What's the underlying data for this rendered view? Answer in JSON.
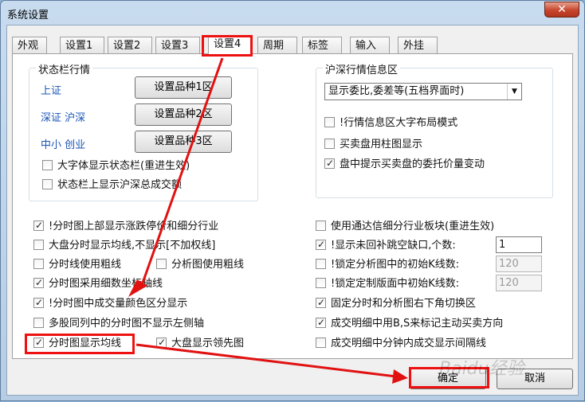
{
  "window": {
    "title": "系统设置",
    "close_glyph": "✕"
  },
  "tabs": [
    "外观",
    "设置1",
    "设置2",
    "设置3",
    "设置4",
    "周期",
    "标签",
    "输入",
    "外挂"
  ],
  "status_group": {
    "title": "状态栏行情",
    "rows": [
      {
        "label": "上证",
        "button": "设置品种1区"
      },
      {
        "label": "深证 沪深",
        "button": "设置品种2区"
      },
      {
        "label": "中小 创业",
        "button": "设置品种3区"
      }
    ],
    "checks": [
      {
        "label": "大字体显示状态栏(重进生效)",
        "checked": false
      },
      {
        "label": "状态栏上显示沪深总成交额",
        "checked": false
      }
    ]
  },
  "info_group": {
    "title": "沪深行情信息区",
    "select_value": "显示委比,委差等(五档界面时)",
    "checks": [
      {
        "label": "!行情信息区大字布局模式",
        "checked": false
      },
      {
        "label": "买卖盘用柱图显示",
        "checked": false
      },
      {
        "label": "盘中提示买卖盘的委托价量变动",
        "checked": true
      }
    ]
  },
  "left_checks": [
    {
      "label": "!分时图上部显示涨跌停价和细分行业",
      "checked": true
    },
    {
      "label": "大盘分时显示均线,不显示[不加权线]",
      "checked": false
    },
    {
      "label": "分时线使用粗线",
      "checked": false
    },
    {
      "label": "分析图使用粗线",
      "checked": false
    },
    {
      "label": "分时图采用细数坐标轴线",
      "checked": true
    },
    {
      "label": "!分时图中成交量颜色区分显示",
      "checked": true
    },
    {
      "label": "多股同列中的分时图不显示左侧轴",
      "checked": false
    },
    {
      "label": "分时图显示均线",
      "checked": true
    },
    {
      "label": "大盘显示领先图",
      "checked": true
    }
  ],
  "right_checks": [
    {
      "label": "使用通达信细分行业板块(重进生效)",
      "checked": false
    },
    {
      "label": "!显示未回补跳空缺口,个数:",
      "checked": true,
      "value": "1",
      "disabled": false
    },
    {
      "label": "!锁定分析图中的初始K线数:",
      "checked": false,
      "value": "120",
      "disabled": true
    },
    {
      "label": "!锁定定制版面中初始K线数:",
      "checked": false,
      "value": "120",
      "disabled": true
    },
    {
      "label": "固定分时和分析图右下角切换区",
      "checked": true
    },
    {
      "label": "成交明细中用B,S来标记主动买卖方向",
      "checked": true
    },
    {
      "label": "成交明细中分钟内成交显示间隔线",
      "checked": false
    }
  ],
  "buttons": {
    "ok": "确定",
    "cancel": "取消"
  },
  "annotation_color": "#e11111",
  "watermark": "Baidu经验"
}
